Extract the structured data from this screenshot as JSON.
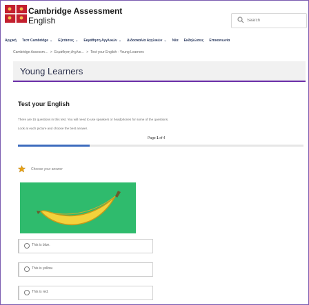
{
  "header": {
    "brand_top": "Cambridge Assessment",
    "brand_bottom": "English",
    "search_placeholder": "Search"
  },
  "nav": {
    "items": [
      {
        "label": "Αρχική"
      },
      {
        "label": "Τεστ Cambridge",
        "has_menu": true
      },
      {
        "label": "Εξετάσεις",
        "has_menu": true
      },
      {
        "label": "Εκμάθηση Αγγλικών",
        "has_menu": true
      },
      {
        "label": "Διδασκαλία Αγγλικών",
        "has_menu": true
      },
      {
        "label": "Νέα"
      },
      {
        "label": "Εκδηλώσεις"
      },
      {
        "label": "Επικοινωνία"
      }
    ]
  },
  "breadcrumb": {
    "items": [
      "Cambridge Assessm…",
      ">",
      "Εκμάθηση Αγγλικ…",
      ">",
      "Test your English - Young Learners"
    ]
  },
  "page": {
    "title": "Young Learners"
  },
  "quiz": {
    "title": "Test your English",
    "intro": "There are 15 questions in this test. You will need to use speakers or headphones for some of the questions.",
    "instruction": "Look at each picture and choose the best answer.",
    "page_prefix": "Page ",
    "page_current": "1",
    "page_suffix": " of 4",
    "progress_fraction": 0.25,
    "prompt": "Choose your answer",
    "answers": [
      {
        "label": "This is blue."
      },
      {
        "label": "This is yellow."
      },
      {
        "label": "This is red."
      }
    ]
  },
  "colors": {
    "accent": "#6a2da8",
    "progress": "#3c6bbd",
    "image_bg": "#2fbb6d",
    "logo_red": "#c3202f",
    "star": "#e6a015"
  },
  "icons": {
    "logo": "cambridge-shield",
    "search": "search-icon",
    "prompt": "star-icon",
    "picture": "banana"
  }
}
